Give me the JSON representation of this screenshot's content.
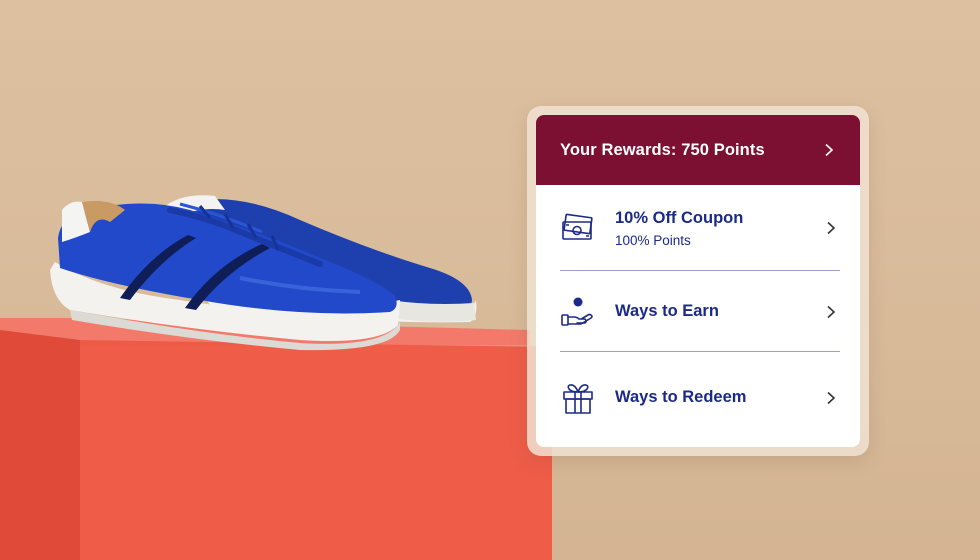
{
  "rewards_card": {
    "header": {
      "title": "Your Rewards: 750 Points",
      "icon": "chevron-right-icon"
    },
    "items": [
      {
        "label": "10% Off Coupon",
        "sublabel": "100% Points",
        "icon": "cash-icon"
      },
      {
        "label": "Ways to Earn",
        "icon": "hand-coin-icon"
      },
      {
        "label": "Ways to Redeem",
        "icon": "gift-icon"
      }
    ]
  },
  "colors": {
    "header_bg": "#7b1033",
    "accent_text": "#1b2a86",
    "background": "#d9bc9b",
    "pedestal": "#ef5a46",
    "shoe": "#1f47c4"
  }
}
